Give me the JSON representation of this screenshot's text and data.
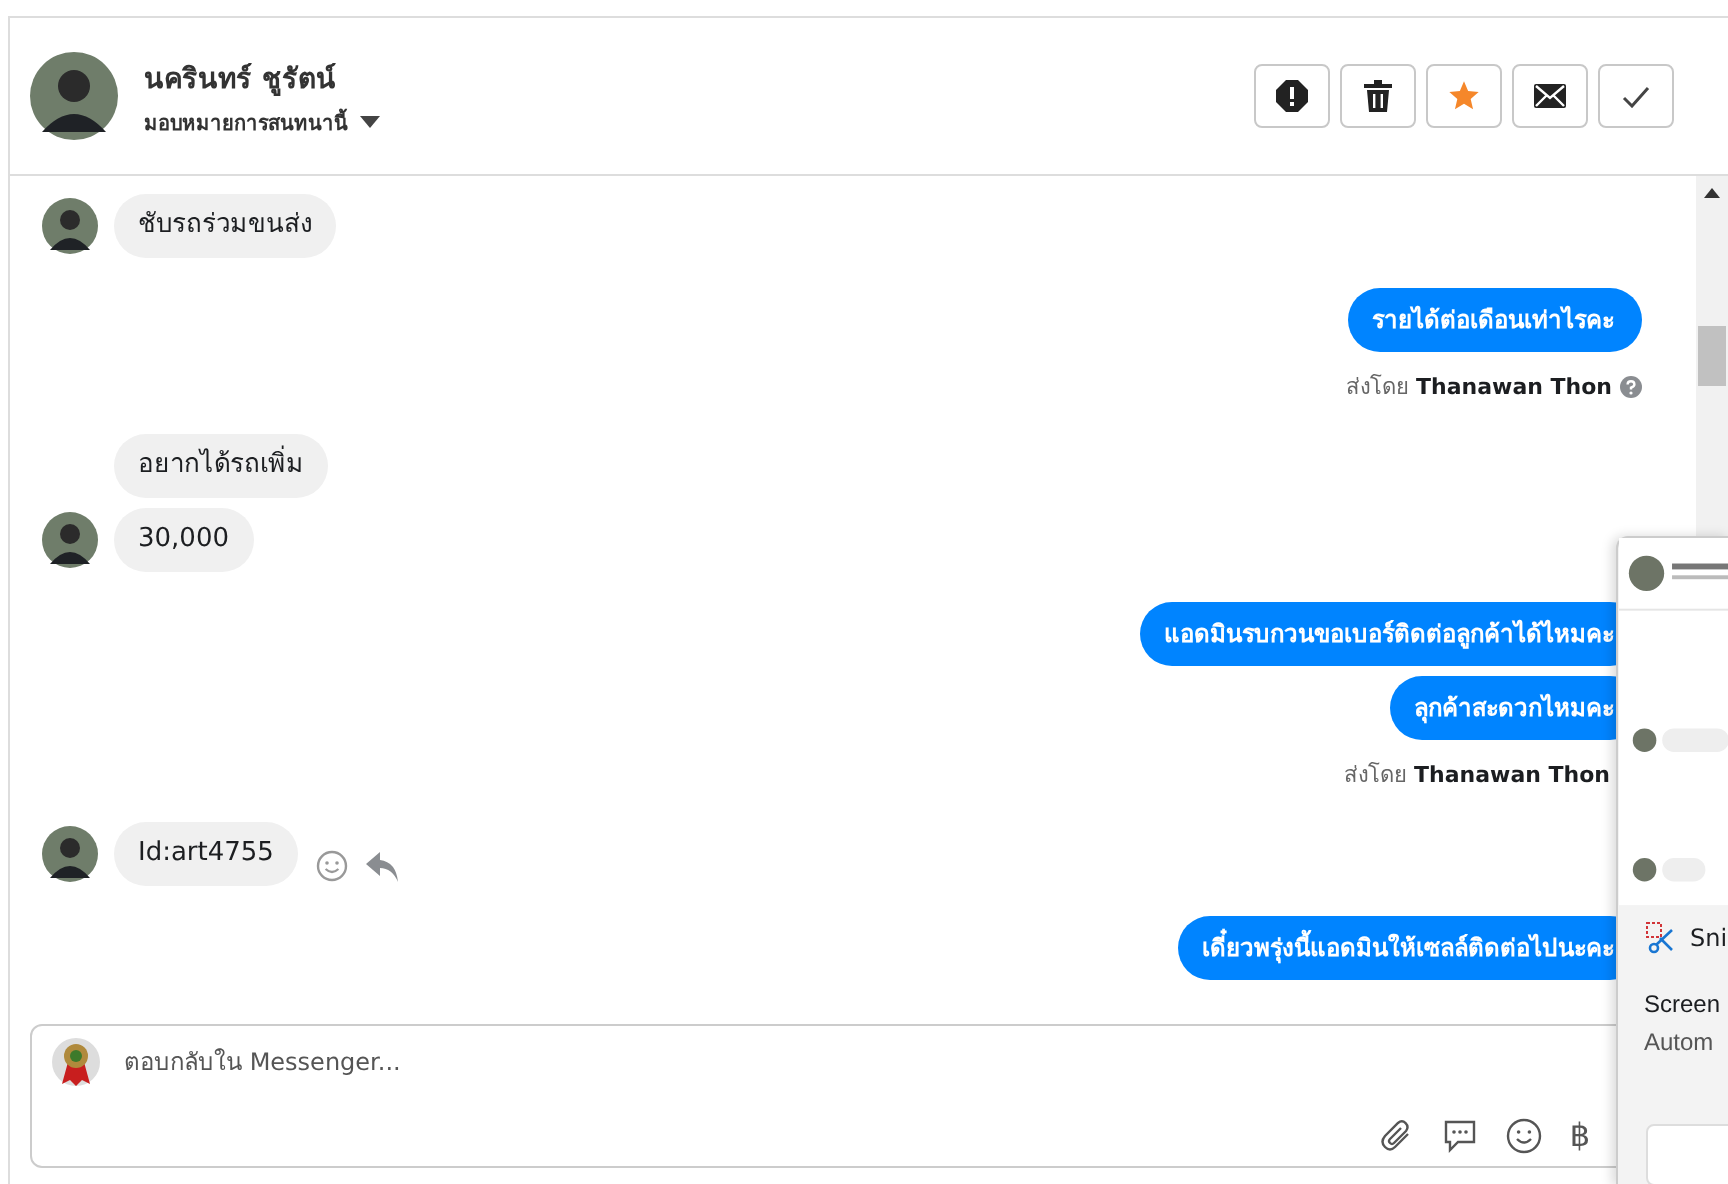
{
  "header": {
    "name": "นครินทร์ ชูรัตน์",
    "assign_label": "มอบหมายการสนทนานี้",
    "buttons": [
      {
        "kind": "alert"
      },
      {
        "kind": "trash"
      },
      {
        "kind": "star"
      },
      {
        "kind": "mail"
      },
      {
        "kind": "check"
      }
    ]
  },
  "groups": [
    {
      "kind": "incoming",
      "messages": [
        "ชับรถร่วมขนส่ง"
      ]
    },
    {
      "kind": "outgoing",
      "messages": [
        "รายได้ต่อเดือนเท่าไรคะ"
      ],
      "sent_by": {
        "prefix": "ส่งโดย",
        "name": "Thanawan Thon",
        "help_icon": true
      }
    },
    {
      "kind": "incoming",
      "messages": [
        "อยากได้รถเพิ่ม",
        "30,000"
      ]
    },
    {
      "kind": "outgoing",
      "messages": [
        "แอดมินรบกวนขอเบอร์ติดต่อลูกค้าได้ไหมคะ",
        "ลุกค้าสะดวกไหมคะ"
      ],
      "sent_by": {
        "prefix": "ส่งโดย",
        "name": "Thanawan Thon",
        "help_icon": false
      }
    },
    {
      "kind": "incoming",
      "messages": [
        "Id:art4755"
      ],
      "actions": true
    },
    {
      "kind": "outgoing",
      "messages": [
        "เดี๋ยวพรุ่งนี้แอดมินให้เซลล์ติดต่อไปนะคะ"
      ]
    }
  ],
  "composer": {
    "placeholder": "ตอบกลับใน Messenger...",
    "currency": "฿"
  },
  "notification": {
    "app": "Sni",
    "title": "Screen",
    "subtitle": "Autom"
  }
}
